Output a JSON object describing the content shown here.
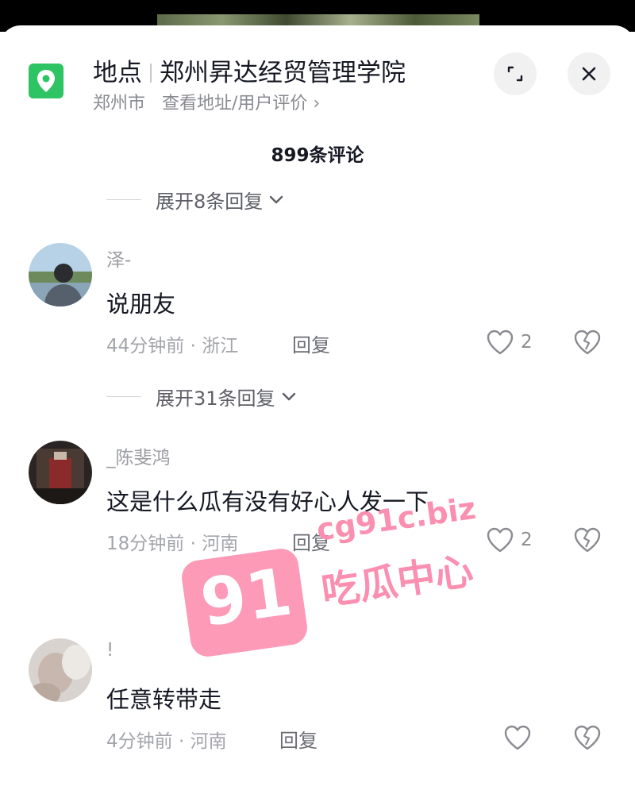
{
  "location": {
    "label": "地点",
    "name": "郑州昇达经贸管理学院",
    "city": "郑州市",
    "link_text": "查看地址/用户评价",
    "link_chevron": "›"
  },
  "header_icons": {
    "pin": "location-pin-icon",
    "expand": "expand-icon",
    "close": "close-icon"
  },
  "comment_count": "899条评论",
  "expand_replies": [
    {
      "label": "展开8条回复"
    },
    {
      "label": "展开31条回复"
    }
  ],
  "comments": [
    {
      "username": "泽-",
      "text": "说朋友",
      "meta": "44分钟前 · 浙江",
      "reply": "回复",
      "likes": "2"
    },
    {
      "username": "_陈斐鸿",
      "text": "这是什么瓜有没有好心人发一下",
      "meta": "18分钟前 · 河南",
      "reply": "回复",
      "likes": "2"
    },
    {
      "username": "!",
      "text": "任意转带走",
      "meta": "4分钟前 · 河南",
      "reply": "回复",
      "likes": ""
    }
  ],
  "watermark": {
    "badge": "91",
    "url": "cg91c.biz",
    "text": "吃瓜中心"
  },
  "colors": {
    "pin_green": "#2ec463",
    "watermark_pink": "#fb8fb1",
    "text_primary": "#161823",
    "text_secondary": "#8a8b91"
  }
}
